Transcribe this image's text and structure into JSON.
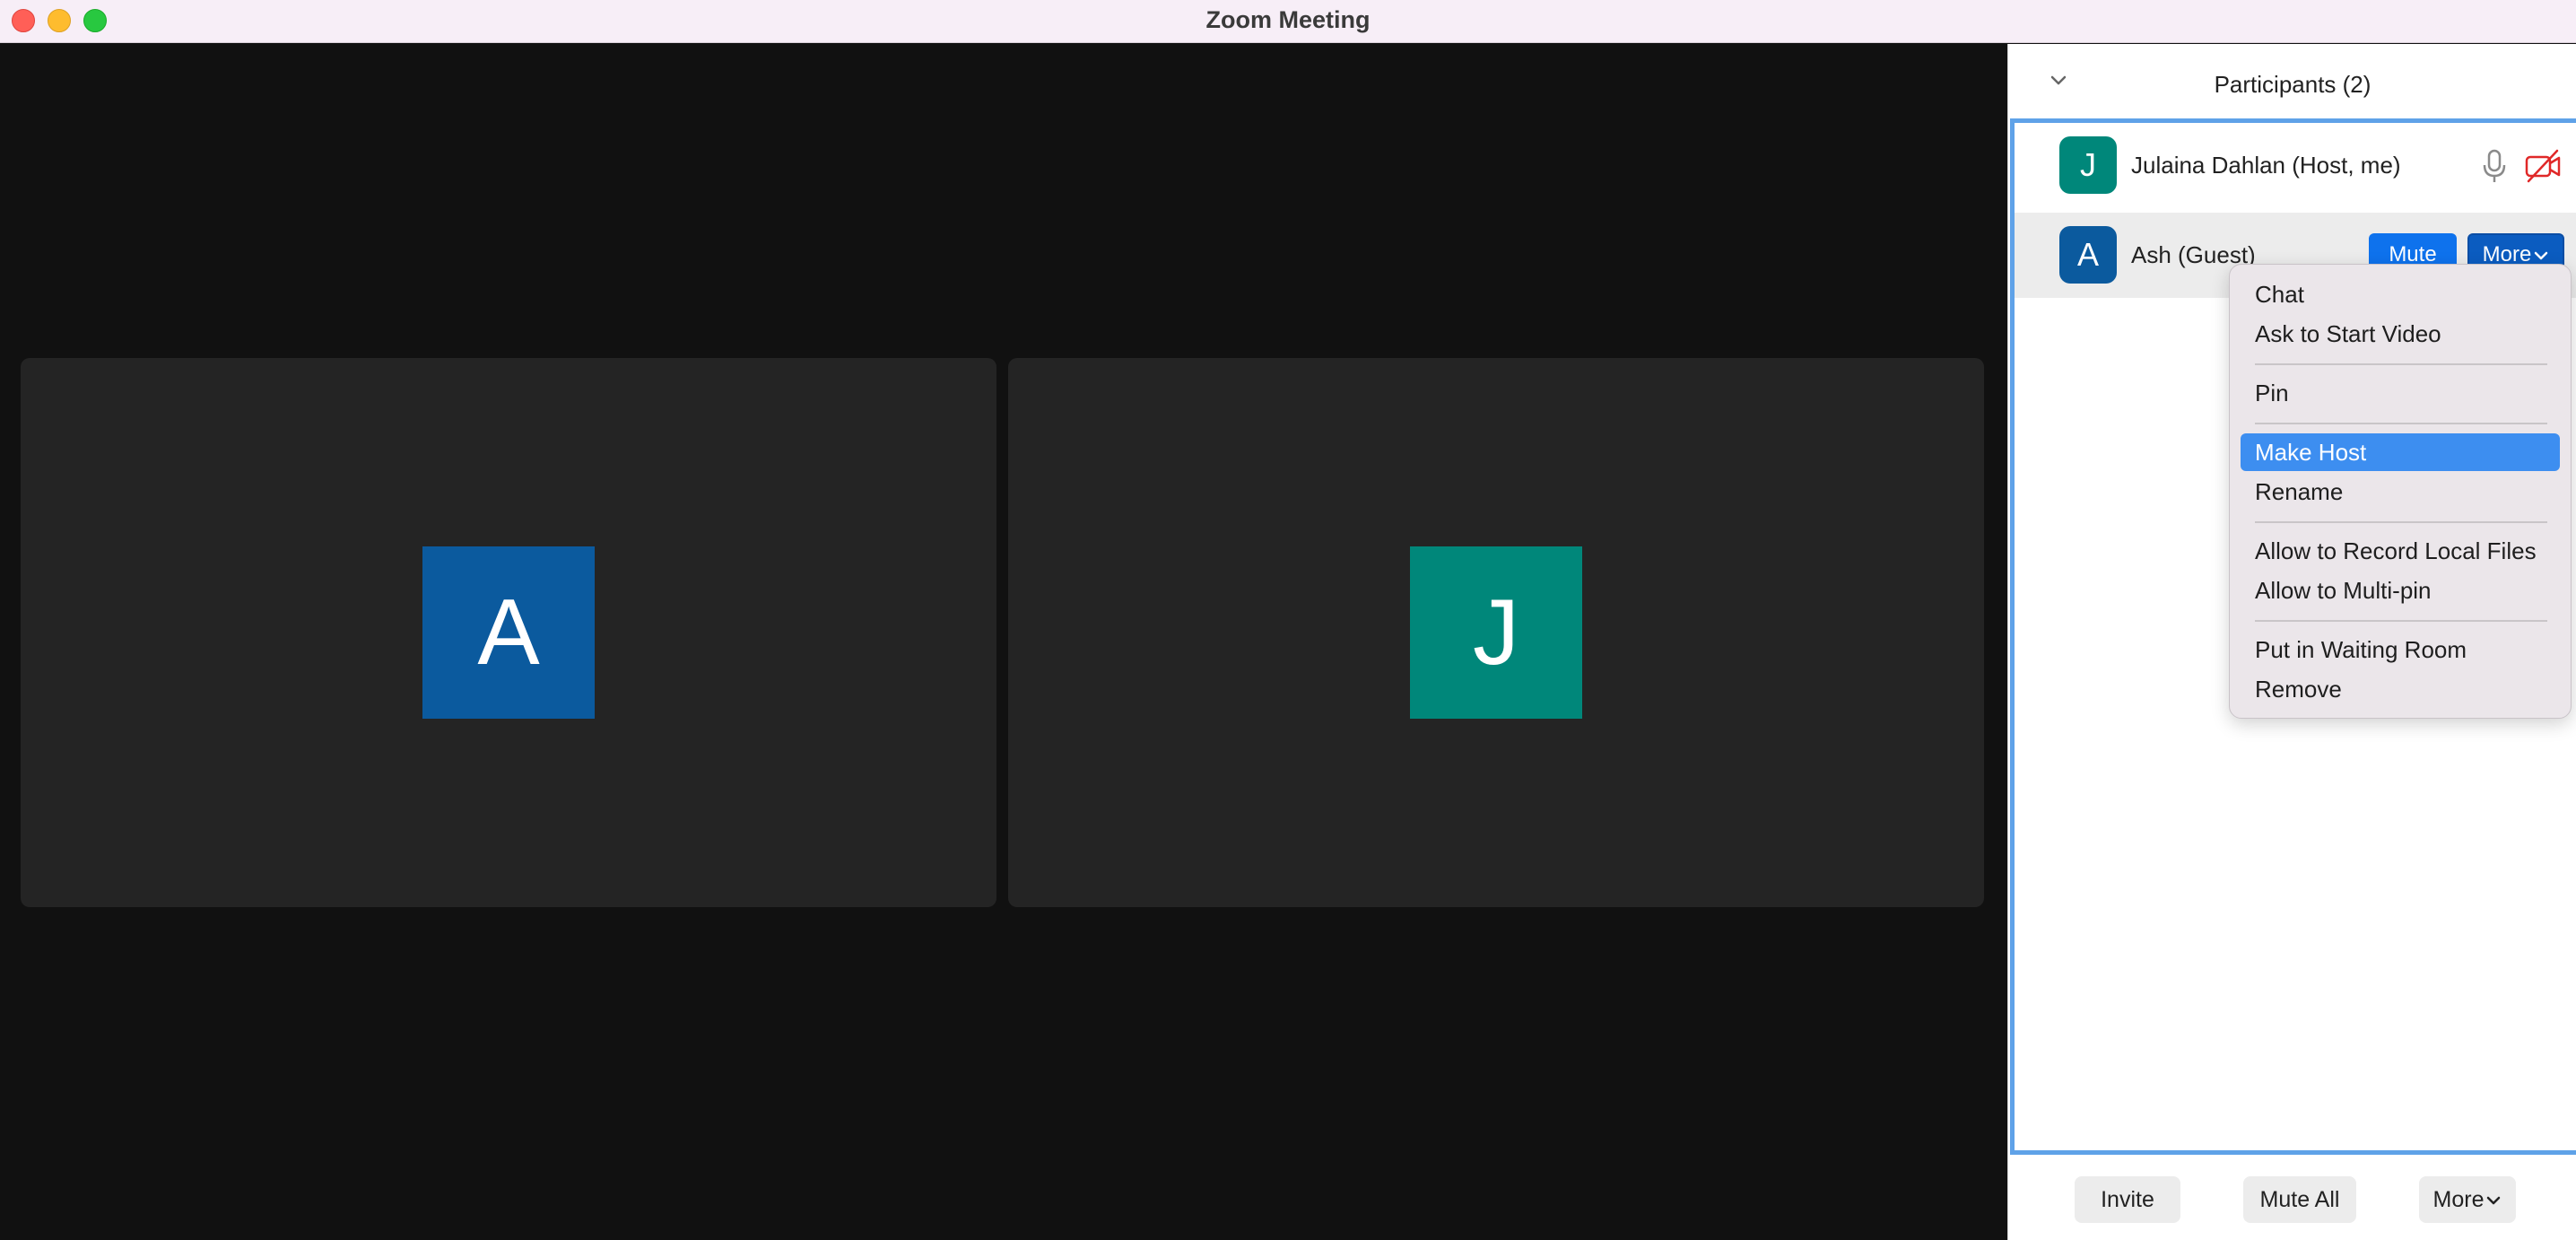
{
  "window": {
    "title": "Zoom Meeting"
  },
  "video": {
    "tiles": [
      {
        "initial": "A",
        "color": "#0b5a9e"
      },
      {
        "initial": "J",
        "color": "#00877a"
      }
    ]
  },
  "participants": {
    "header": "Participants (2)",
    "rows": [
      {
        "initial": "J",
        "name": "Julaina Dahlan (Host, me)",
        "color": "#00877a",
        "mic": "mic-icon",
        "video": "video-off-icon"
      },
      {
        "initial": "A",
        "name": "Ash (Guest)",
        "color": "#0b5a9e",
        "mute_label": "Mute",
        "more_label": "More"
      }
    ],
    "footer": {
      "invite": "Invite",
      "mute_all": "Mute All",
      "more": "More"
    }
  },
  "context_menu": {
    "items": [
      "Chat",
      "Ask to Start Video",
      "Pin",
      "Make Host",
      "Rename",
      "Allow to Record Local Files",
      "Allow to Multi-pin",
      "Put in Waiting Room",
      "Remove"
    ],
    "highlighted": "Make Host"
  },
  "colors": {
    "accent": "#0e72ed",
    "panel_border": "#5fa2e8",
    "highlight": "#3d8ef0"
  }
}
